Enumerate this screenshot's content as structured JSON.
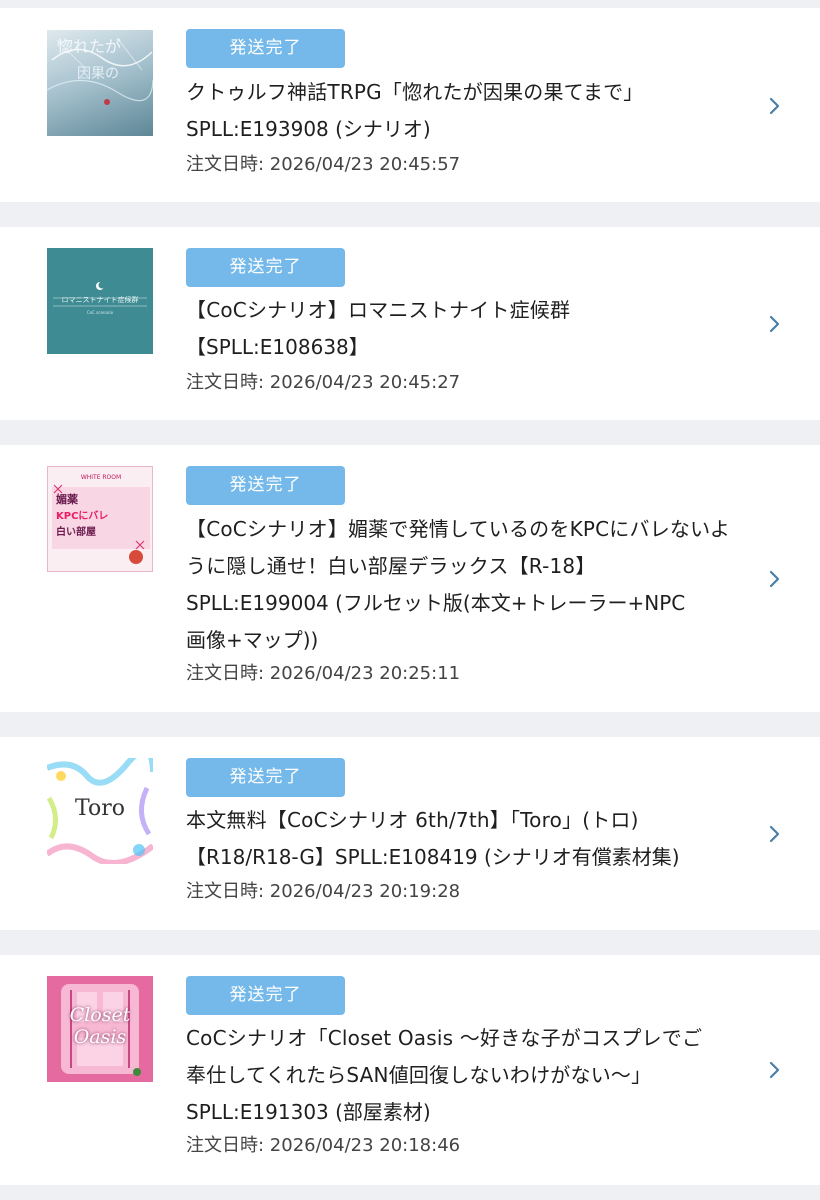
{
  "orders": [
    {
      "status": "発送完了",
      "title": "クトゥルフ神話TRPG「惚れたが因果の果てまで」",
      "sku": "SPLL:E193908 (シナリオ)",
      "date": "注文日時: 2026/04/23 20:45:57",
      "thumb_icon": "scenario-cover-image"
    },
    {
      "status": "発送完了",
      "title": "【CoCシナリオ】ロマニストナイト症候群",
      "sku": "【SPLL:E108638】",
      "date": "注文日時: 2026/04/23 20:45:27",
      "thumb_icon": "scenario-cover-image"
    },
    {
      "status": "発送完了",
      "title_line1": "【CoCシナリオ】媚薬で発情しているのをKPCにバレないよ",
      "title_line2": "うに隠し通せ！白い部屋デラックス【R-18】",
      "sku_line1": "SPLL:E199004 (フルセット版(本文+トレーラー+NPC",
      "sku_line2": "画像+マップ))",
      "date": "注文日時: 2026/04/23 20:25:11",
      "thumb_icon": "scenario-cover-image"
    },
    {
      "status": "発送完了",
      "title": "本文無料【CoCシナリオ 6th/7th】「Toro」(トロ)",
      "sku": "【R18/R18-G】SPLL:E108419 (シナリオ有償素材集)",
      "date": "注文日時: 2026/04/23 20:19:28",
      "thumb_icon": "scenario-cover-image",
      "thumb_text": "Toro"
    },
    {
      "status": "発送完了",
      "title_line1": "CoCシナリオ「Closet Oasis 〜好きな子がコスプレでご",
      "title_line2": "奉仕してくれたらSAN値回復しないわけがない〜」",
      "sku": "SPLL:E191303 (部屋素材)",
      "date": "注文日時: 2026/04/23 20:18:46",
      "thumb_icon": "scenario-cover-image",
      "thumb_text_1": "Closet",
      "thumb_text_2": "Oasis"
    }
  ],
  "colors": {
    "badge": "#74b9ea",
    "chevron": "#4a7fa8",
    "page_bg": "#eef0f4"
  },
  "icons": {
    "chevron": "chevron-right-icon"
  }
}
